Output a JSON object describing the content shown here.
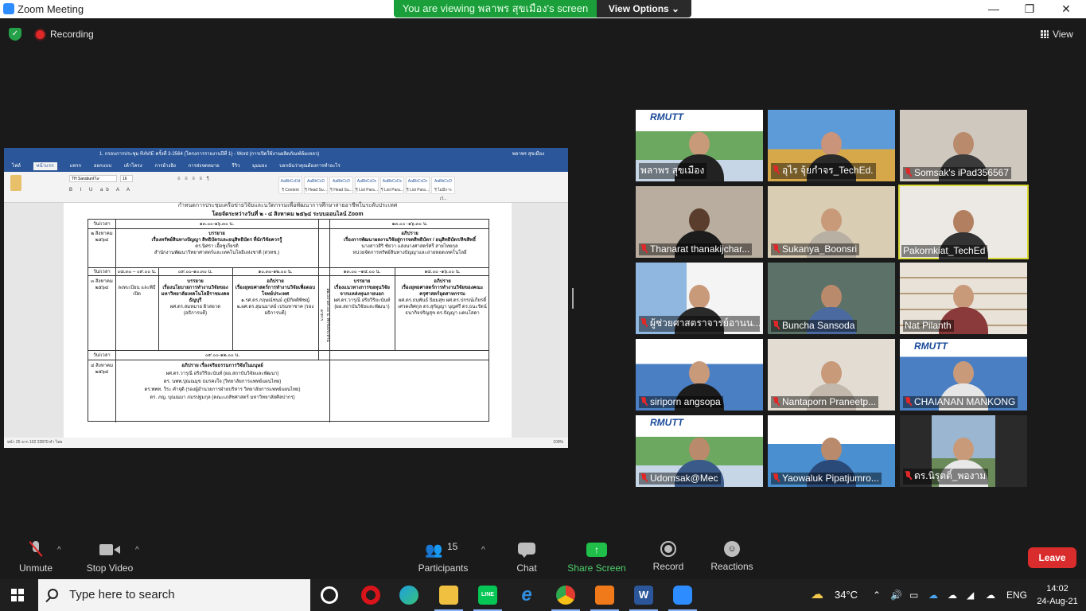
{
  "window": {
    "title": "Zoom Meeting",
    "minimize": "—",
    "restore": "❐",
    "close": "✕"
  },
  "banner": {
    "viewing": "You are viewing พลาพร สุขเมือง's screen",
    "view_options": "View Options ⌄"
  },
  "topbar": {
    "recording": "Recording",
    "view": "View"
  },
  "shared_doc": {
    "title": "1. กรอบการประชุม RAVIE ครั้งที่ 3-2564 (โครงการรายงานปีที่ 1) - Word (การเปิดใช้งานผลิตภัณฑ์ล้มเหลว)",
    "user": "พลาพร สุขเมือง",
    "tabs": [
      "ไฟล์",
      "หน้าแรก",
      "แทรก",
      "ออกแบบ",
      "เค้าโครง",
      "การอ้างอิง",
      "การส่งจดหมาย",
      "รีวิว",
      "มุมมอง",
      "บอกฉันว่าคุณต้องการทำอะไร"
    ],
    "font_name": "TH SarabunIT๙",
    "font_size": "16",
    "styles": [
      "AaBbCcDd",
      "AaBbCcD",
      "AaBbCcD",
      "AaBbCcDc",
      "AaBbCcDc",
      "AaBbCcDc",
      "AaBbCcD"
    ],
    "style_names": [
      "¶ Content",
      "¶ Head Su...",
      "¶ Head Su...",
      "¶ List Para...",
      "¶ List Para...",
      "¶ List Para...",
      "¶ ไม่มีการเว้..."
    ],
    "heading_line": "โดยจัดระหว่างวันที่ ๒ - ๔ สิงหาคม ๒๕๖๔ ระบบออนไลน์ Zoom",
    "top_cut": "กำหนดการประชุมเครือข่ายวิจัยและนวัตกรรมเพื่อพัฒนาการศึกษาสายอาชีพในระดับประเทศ",
    "rows": {
      "r1_time_label": "วัน/เวลา",
      "r1_time_a": "๑๓.๐๐-๑๖.๓๐ น.",
      "r1_time_b": "๑๓.๐๐ -๑๖.๓๐ น.",
      "d2_label": "๒ สิงหาคม ๒๕๖๔",
      "d2_a_title": "บรรยาย",
      "d2_a_text": "เรื่องทรัพย์สินทางปัญญา สิทธิบัตรและอนุสิทธิบัตร ที่นักวิจัยควรรู้",
      "d2_a_by": "ดร.นิศรา  เอื้อชูเกียรติ",
      "d2_a_org": "สำนักงานพัฒนาวิทยาศาสตร์และเทคโนโลยีแห่งชาติ (สวทช.)",
      "d2_b_title": "อภิปราย",
      "d2_b_text": "เรื่องการพัฒนาผลงานวิจัยสู่การจดสิทธิบัตร / อนุสิทธิบัตร/ลิขสิทธิ์",
      "d2_b_by": "นางสาวสิริ ชัยวา แสงนางศาสตร์ศรี  สายไทยกุล",
      "d2_b_org": "หน่วยจัดการทรัพย์สินทางปัญญาและถ่ายทอดเทคโนโลยี",
      "r2_time_label": "วัน/เวลา",
      "r2_t1": "๐๘.๓๐ – ๐๙.๐๐ น.",
      "r2_t2": "๐๙.๐๐-๑๐.๓๐ น.",
      "r2_t3": "๑๐.๓๐-๑๒.๐๐ น.",
      "r2_t4": "๑๓.๐๐ –๑๔.๐๐ น.",
      "r2_t5": "๑๔.๐๐ -๑๖.๐๐ น.",
      "d3_label": "๓ สิงหาคม ๒๕๖๔",
      "d3_reg": "ลงทะเบียน และพิธีเปิด",
      "d3_c1_title": "บรรยาย",
      "d3_c1_text": "เรื่องนโยบายการทำงานวิจัยของมหาวิทยาลัยเทคโนโลยีราชมงคลธัญบุรี",
      "d3_c1_by": "ผศ.ดร.สมหมาย  ผิวสอาด (อธิการบดี)",
      "d3_c2_title": "อภิปราย",
      "d3_c2_text": "เรื่องยุทธศาสตร์การทำงานวิจัยเพื่อตอบโจทย์ประเทศ",
      "d3_c2_by": "๑.รศ.ดร.กฤษณ์ชนม์ ภูมิกิตติพิชญ์ ๒.ผศ.ดร.สุมนมาลย์ เปรมหาชาค (รองอธิการบดี)",
      "d3_lunch": "๑๒.๐๐-๑๓.๐๐ น. พักรับประทานอาหาร",
      "d3_c3_title": "บรรยาย",
      "d3_c3_text": "เรื่องแนวทางการขอทุนวิจัยจากแหล่งทุนภายนอก",
      "d3_c3_by": "ผศ.ดร.วารุณี อริยวิริยะนันท์ (ผอ.สถาบันวิจัยและพัฒนา)",
      "d3_c4_title": "อภิปราย",
      "d3_c4_text": "เรื่องยุทธศาสตร์การทำงานวิจัยของคณะครุศาสตร์อุตสาหกรรม",
      "d3_c4_by": "ผศ.ดร.ธนพันธ์  นิยมสุข ผศ.ดร.ปกรณ์เกียรติ์  เศวตเลิศกุล ดร.สุกัญญา  บุญศรี ดร.ธนะรัตน์  ธนากิจจริญสุข ดร.ปัญญา  แดนโสดา",
      "r3_time_label": "วัน/เวลา",
      "r3_time_a": "๐๙.๐๐-๑๒.๐๐ น.",
      "d4_label": "๔ สิงหาคม ๒๕๖๔",
      "d4_title": "อภิปราย  เรื่องจริยธรรมการวิจัยในมนุษย์",
      "d4_p1": "ผศ.ดร.วารุณี  อริยวิริยะนันท์   (ผอ.สถาบันวิจัยและพัฒนา)",
      "d4_p2": "ดร. นพพ.ปุณณมุข  ธมรคงใจ  (วิทยาลัยการแพทย์แผนไทย)",
      "d4_p3": "ดร.พพท. วีระ คำจุติ (รองผู้อำนวยการฝ่ายบริหาร วิทยาลัยการแพทย์แผนไทย)",
      "d4_p4": "ดร. ภญ. บุณณมา ภมรปฐมกุล (คณะเภสัชศาสตร์  มหาวิทยาลัยศิลปากร)"
    },
    "status": "หน้า 25 จาก 102    22870 คำ    ไทย",
    "zoom": "100%"
  },
  "participants_tiles": [
    {
      "name": "พลาพร สุขเมือง",
      "muted": false
    },
    {
      "name": "อุไร จุ้ยกำจร_TechEd.",
      "muted": true
    },
    {
      "name": "Somsak's iPad356567",
      "muted": true
    },
    {
      "name": "Thanarat thanakijchar...",
      "muted": true
    },
    {
      "name": "Sukanya_Boonsri",
      "muted": true
    },
    {
      "name": "Pakornkiat_TechEd",
      "muted": false
    },
    {
      "name": "ผู้ช่วยศาสตราจารย์อานน...",
      "muted": true
    },
    {
      "name": "Buncha Sansoda",
      "muted": true
    },
    {
      "name": "Nat Pilanth",
      "muted": false
    },
    {
      "name": "siriporn angsopa",
      "muted": true
    },
    {
      "name": "Nantaporn Praneetp...",
      "muted": true
    },
    {
      "name": "CHAIANAN MANKONG",
      "muted": true
    },
    {
      "name": "Udomsak@Mec",
      "muted": true
    },
    {
      "name": "Yaowaluk Pipatjumro...",
      "muted": true
    },
    {
      "name": "ดร.นิรุตติ์_พองาม",
      "muted": true
    }
  ],
  "tile_logo": "RMUTT",
  "toolbar": {
    "unmute": "Unmute",
    "stop_video": "Stop Video",
    "participants_count": "15",
    "participants": "Participants",
    "chat": "Chat",
    "share_screen": "Share Screen",
    "record": "Record",
    "reactions": "Reactions",
    "leave": "Leave",
    "caret": "^"
  },
  "taskbar": {
    "search_placeholder": "Type here to search",
    "temperature": "34°C",
    "language": "ENG",
    "time": "14:02",
    "date": "24-Aug-21"
  },
  "colors": {
    "accent_green": "#1a9f3b",
    "leave_red": "#d92c2c",
    "active_speaker": "#d8d832",
    "zoom_blue": "#2d8cff"
  }
}
